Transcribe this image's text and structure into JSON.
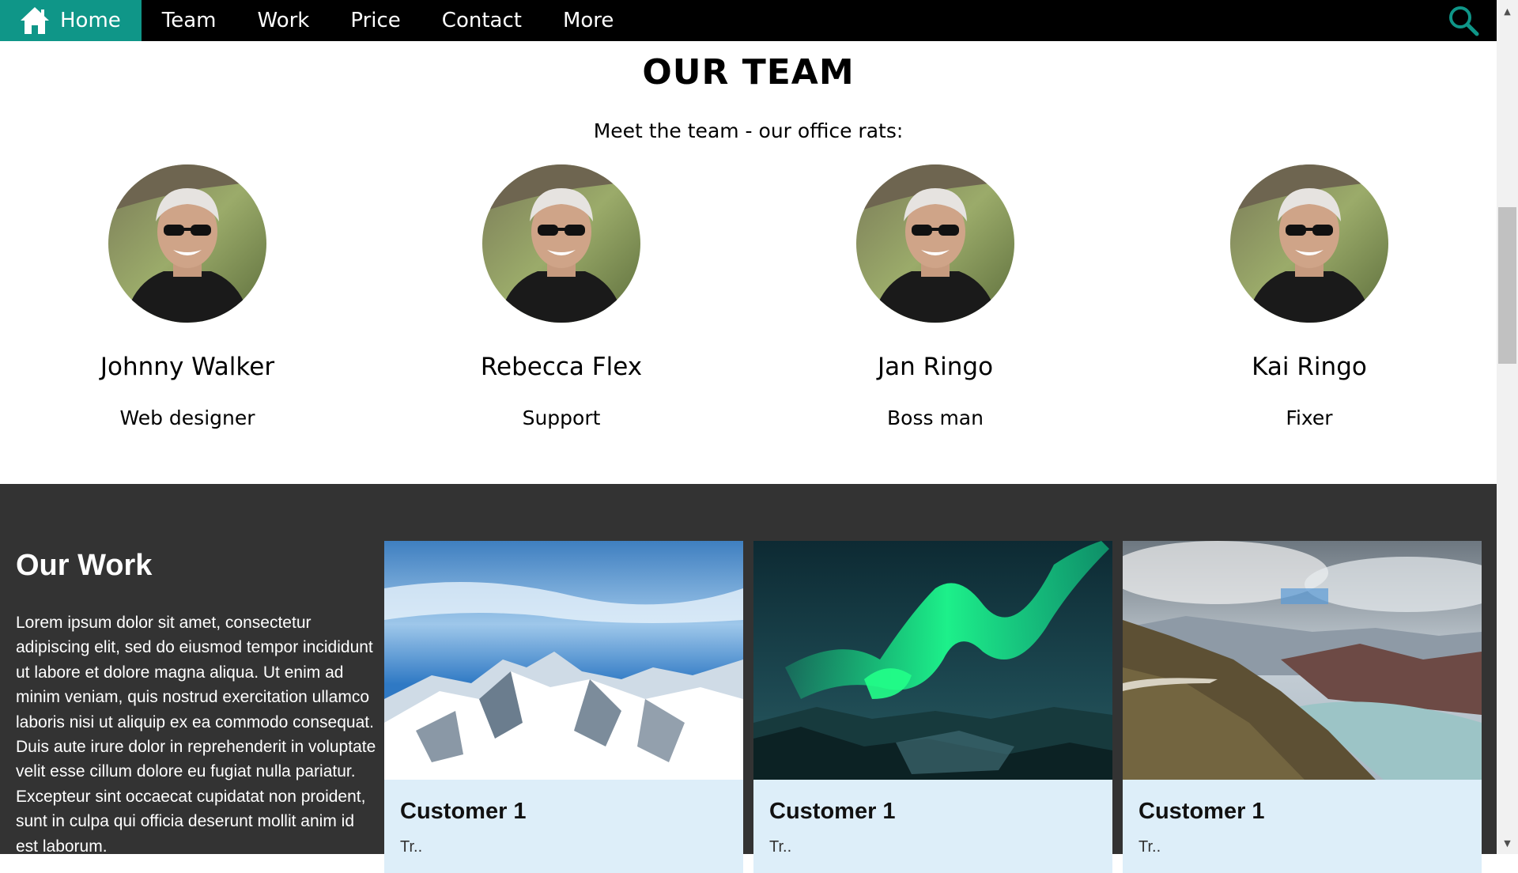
{
  "nav": {
    "items": [
      {
        "label": "Home",
        "icon": "home-icon",
        "active": true
      },
      {
        "label": "Team"
      },
      {
        "label": "Work"
      },
      {
        "label": "Price"
      },
      {
        "label": "Contact"
      },
      {
        "label": "More"
      }
    ],
    "search_icon": "search-icon",
    "accent_color": "#0f9688",
    "background_color": "#000000"
  },
  "team": {
    "title": "OUR TEAM",
    "subtitle": "Meet the team - our office rats:",
    "members": [
      {
        "name": "Johnny Walker",
        "role": "Web designer"
      },
      {
        "name": "Rebecca Flex",
        "role": "Support"
      },
      {
        "name": "Jan Ringo",
        "role": "Boss man"
      },
      {
        "name": "Kai Ringo",
        "role": "Fixer"
      }
    ]
  },
  "work": {
    "title": "Our Work",
    "text": "Lorem ipsum dolor sit amet, consectetur adipiscing elit, sed do eiusmod tempor incididunt ut labore et dolore magna aliqua. Ut enim ad minim veniam, quis nostrud exercitation ullamco laboris nisi ut aliquip ex ea commodo consequat. Duis aute irure dolor in reprehenderit in voluptate velit esse cillum dolore eu fugiat nulla pariatur. Excepteur sint occaecat cupidatat non proident, sunt in culpa qui officia deserunt mollit anim id est laborum.",
    "background_color": "#333333",
    "cards": [
      {
        "title": "Customer 1",
        "subtitle": "Tr..",
        "image": "snowy-mountains"
      },
      {
        "title": "Customer 1",
        "subtitle": "Tr..",
        "image": "northern-lights"
      },
      {
        "title": "Customer 1",
        "subtitle": "Tr..",
        "image": "mountain-lake-valley"
      }
    ]
  }
}
